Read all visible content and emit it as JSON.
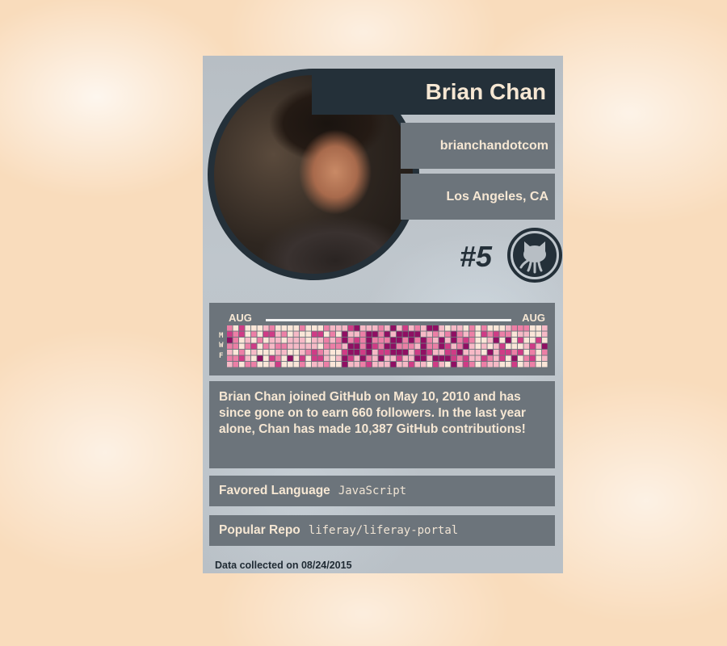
{
  "profile": {
    "name": "Brian Chan",
    "username": "brianchandotcom",
    "location": "Los Angeles, CA",
    "rank": "#5"
  },
  "contributions": {
    "start_month": "AUG",
    "end_month": "AUG",
    "day_labels": [
      "M",
      "W",
      "F"
    ],
    "levels_note": "0-4 intensity per day",
    "palette": [
      "#fbe6d8",
      "#f6b9c6",
      "#ec7fa6",
      "#cf3c86",
      "#8f0f63"
    ]
  },
  "bio": {
    "text": "Brian Chan joined GitHub on May 10, 2010 and has since gone on to earn 660 followers. In the last year alone, Chan has made 10,387 GitHub contributions!"
  },
  "favored_language": {
    "label": "Favored Language",
    "value": "JavaScript"
  },
  "popular_repo": {
    "label": "Popular Repo",
    "value": "liferay/liferay-portal"
  },
  "footer": {
    "text": "Data collected on 08/24/2015"
  },
  "colors": {
    "dark": "#243039",
    "panel": "#6c747b",
    "cream_text": "#f6e7d3"
  },
  "icons": {
    "github": "octocat-icon"
  }
}
